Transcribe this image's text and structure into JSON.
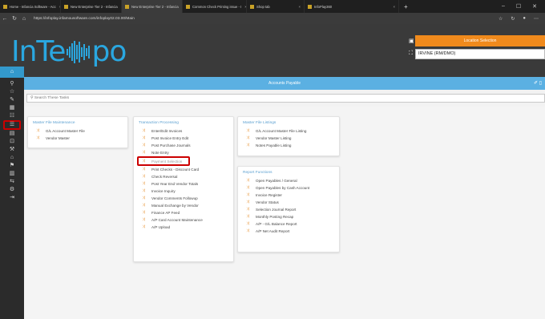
{
  "browser": {
    "tabs": [
      {
        "label": "Home - Infancia Software - Acc",
        "active": false
      },
      {
        "label": "New Enterprise Tier 2 - Infancia",
        "active": false
      },
      {
        "label": "New Enterprise Tier 2 - Infancia",
        "active": true
      },
      {
        "label": "Common Check Printing issue - I",
        "active": false
      },
      {
        "label": "Shop tab",
        "active": false
      },
      {
        "label": "InfoPlay360",
        "active": false
      }
    ],
    "new_tab": "+",
    "url": "https://infoplay.infamousoftware.com/infoplay02.03.00/Main",
    "controls": [
      "–",
      "☐",
      "✕"
    ]
  },
  "header": {
    "logo_left": "InTe",
    "logo_right": "po",
    "location_title": "Location Selection",
    "location_value": "IRVINE (RM/DMO)"
  },
  "sidebar": {
    "home_icon": "⌂",
    "icons": [
      {
        "name": "search-icon",
        "glyph": "⚲",
        "highlight": false
      },
      {
        "name": "star-icon",
        "glyph": "☆",
        "highlight": false
      },
      {
        "name": "tools-icon",
        "glyph": "✎",
        "highlight": false
      },
      {
        "name": "calculator-icon",
        "glyph": "▦",
        "highlight": false
      },
      {
        "name": "users-icon",
        "glyph": "☷",
        "highlight": false
      },
      {
        "name": "money-icon",
        "glyph": "☰",
        "highlight": true
      },
      {
        "name": "inventory-icon",
        "glyph": "▤",
        "highlight": false
      },
      {
        "name": "orders-icon",
        "glyph": "⊡",
        "highlight": false
      },
      {
        "name": "wrench-icon",
        "glyph": "⚒",
        "highlight": false
      },
      {
        "name": "bank-icon",
        "glyph": "⌂",
        "highlight": false
      },
      {
        "name": "shipping-icon",
        "glyph": "⚑",
        "highlight": false
      },
      {
        "name": "document-icon",
        "glyph": "▥",
        "highlight": false
      },
      {
        "name": "chart-icon",
        "glyph": "⇆",
        "highlight": false
      },
      {
        "name": "settings-icon",
        "glyph": "⚙",
        "highlight": false
      },
      {
        "name": "logout-icon",
        "glyph": "⇥",
        "highlight": false
      }
    ]
  },
  "main": {
    "title": "Accounts Payable",
    "search_placeholder": "Search These Tasks",
    "cards": [
      {
        "title": "Master File Maintenance",
        "items": [
          "G/L Account Master File",
          "Vendor Master"
        ]
      },
      {
        "title": "Transaction Processing",
        "items": [
          "Enter/Edit Invoices",
          "Post Invoice Entry Edit",
          "Post Purchase Journals",
          "Note Entry",
          "Payment Selection",
          "Print Checks - Discount Card",
          "Check Reversal",
          "Post Year End Vendor Totals",
          "Invoice Inquiry",
          "Vendor Comments Followup",
          "Manual Exchange by Vendor",
          "Finance AP Feed",
          "A/P Card Account Maintenance",
          "A/P Upload"
        ]
      },
      {
        "title": "Master File Listings",
        "items": [
          "G/L Account Master File Listing",
          "Vendor Master Listing",
          "Notes Payable Listing"
        ]
      },
      {
        "title": "Report Functions",
        "items": [
          "Open Payables / General",
          "Open Payables by Cash Account",
          "Invoice Register",
          "Vendor Status",
          "Selection Journal Report",
          "Monthly Posting Recap",
          "A/P - G/L Balance Report",
          "A/P Net Audit Report"
        ]
      }
    ]
  }
}
